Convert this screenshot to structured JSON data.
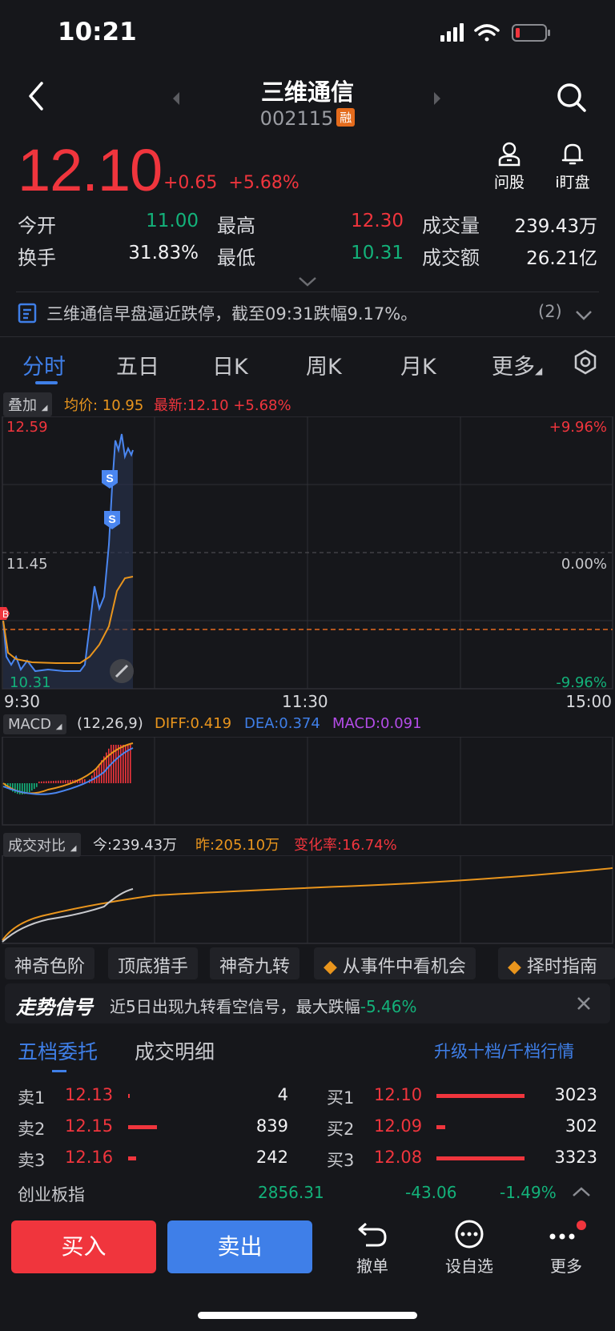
{
  "status_bar": {
    "time": "10:21"
  },
  "header": {
    "name": "三维通信",
    "code": "002115",
    "badge": "融"
  },
  "price": {
    "last": "12.10",
    "change": "+0.65",
    "change_pct": "+5.68%"
  },
  "tools": {
    "ask": "问股",
    "watch": "i盯盘"
  },
  "quote": {
    "open_label": "今开",
    "open": "11.00",
    "high_label": "最高",
    "high": "12.30",
    "vol_label": "成交量",
    "vol": "239.43万",
    "turnover_label": "换手",
    "turnover": "31.83%",
    "low_label": "最低",
    "low": "10.31",
    "amount_label": "成交额",
    "amount": "26.21亿"
  },
  "news": {
    "text": "三维通信早盘逼近跌停，截至09:31跌幅9.17%。",
    "count": "(2)"
  },
  "tabs": [
    "分时",
    "五日",
    "日K",
    "周K",
    "月K",
    "更多"
  ],
  "intraday": {
    "overlay_btn": "叠加",
    "avg_label": "均价: 10.95",
    "latest_label": "最新:12.10 +5.68%",
    "y_top": "12.59",
    "y_mid": "11.45",
    "y_bot": "10.31",
    "pct_top": "+9.96%",
    "pct_mid": "0.00%",
    "pct_bot": "-9.96%",
    "time_start": "9:30",
    "time_mid": "11:30",
    "time_end": "15:00",
    "marker_s": "S",
    "marker_b": "B"
  },
  "macd": {
    "btn": "MACD",
    "params": "(12,26,9)",
    "diff": "DIFF:0.419",
    "dea": "DEA:0.374",
    "macd": "MACD:0.091"
  },
  "volume_compare": {
    "btn": "成交对比",
    "today": "今:239.43万",
    "yesterday": "昨:205.10万",
    "change": "变化率:16.74%"
  },
  "features": [
    "神奇色阶",
    "顶底猎手",
    "神奇九转",
    "从事件中看机会",
    "择时指南"
  ],
  "signal": {
    "title": "走势信号",
    "text": "近5日出现九转看空信号，最大跌幅",
    "value": "-5.46%"
  },
  "orderbook": {
    "tab_active": "五档委托",
    "tab_other": "成交明细",
    "upgrade": "升级十档/千档行情",
    "asks": [
      {
        "label": "卖1",
        "price": "12.13",
        "qty": "4",
        "ratio": 0.02
      },
      {
        "label": "卖2",
        "price": "12.15",
        "qty": "839",
        "ratio": 0.33
      },
      {
        "label": "卖3",
        "price": "12.16",
        "qty": "242",
        "ratio": 0.09
      }
    ],
    "bids": [
      {
        "label": "买1",
        "price": "12.10",
        "qty": "3023",
        "ratio": 1.0
      },
      {
        "label": "买2",
        "price": "12.09",
        "qty": "302",
        "ratio": 0.1
      },
      {
        "label": "买3",
        "price": "12.08",
        "qty": "3323",
        "ratio": 1.0
      }
    ]
  },
  "index": {
    "name": "创业板指",
    "value": "2856.31",
    "change": "-43.06",
    "pct": "-1.49%"
  },
  "actions": {
    "buy": "买入",
    "sell": "卖出",
    "cancel": "撤单",
    "favorite": "设自选",
    "more": "更多"
  },
  "colors": {
    "up": "#f0353d",
    "down": "#13b27a",
    "accent": "#3f7fe8",
    "avg_line": "#e9951d"
  }
}
